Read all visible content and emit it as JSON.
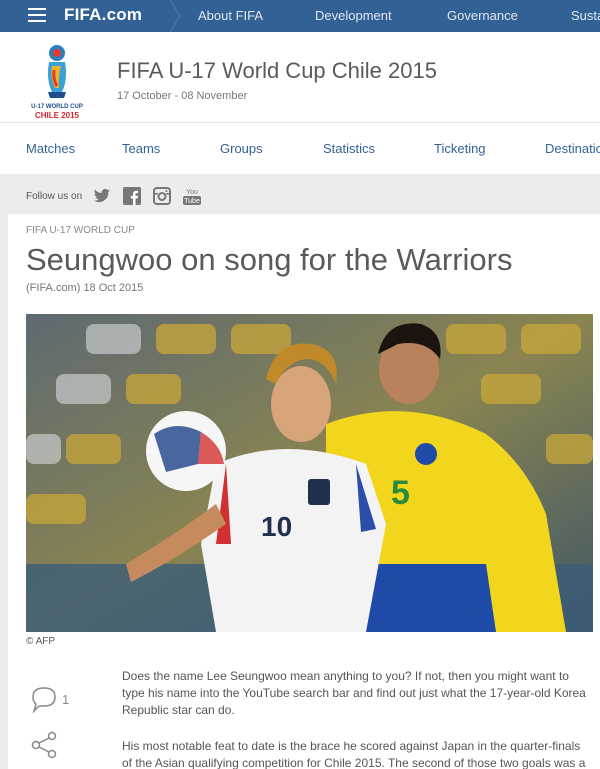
{
  "topbar": {
    "logo_main": "FIFA",
    "logo_suffix": ".com",
    "nav": [
      "About FIFA",
      "Development",
      "Governance",
      "Susta"
    ]
  },
  "event": {
    "title": "FIFA U-17 World Cup Chile 2015",
    "dates": "17 October - 08 November",
    "emblem_text_1": "U-17 WORLD CUP",
    "emblem_text_2": "CHILE 2015"
  },
  "subnav": [
    "Matches",
    "Teams",
    "Groups",
    "Statistics",
    "Ticketing",
    "Destinatio"
  ],
  "follow": {
    "label": "Follow us on",
    "networks": [
      "twitter-icon",
      "facebook-icon",
      "instagram-icon",
      "youtube-icon"
    ]
  },
  "article": {
    "kicker": "FIFA U-17 WORLD CUP",
    "headline": "Seungwoo on song for the Warriors",
    "byline": "(FIFA.com) 18 Oct 2015",
    "photo_credit": "© AFP",
    "paragraphs": [
      "Does the name Lee Seungwoo mean anything to you? If not, then you might want to type his name into the YouTube search bar and find out just what the 17-year-old Korea Republic star can do.",
      "His most notable feat to date is the brace he scored against Japan in the quarter-finals of the Asian qualifying competition for Chile 2015. The second of those two goals was a"
    ],
    "comment_count": "1"
  },
  "colors": {
    "brand_blue": "#326295",
    "link_blue": "#326295",
    "gray_bg": "#ececec"
  }
}
